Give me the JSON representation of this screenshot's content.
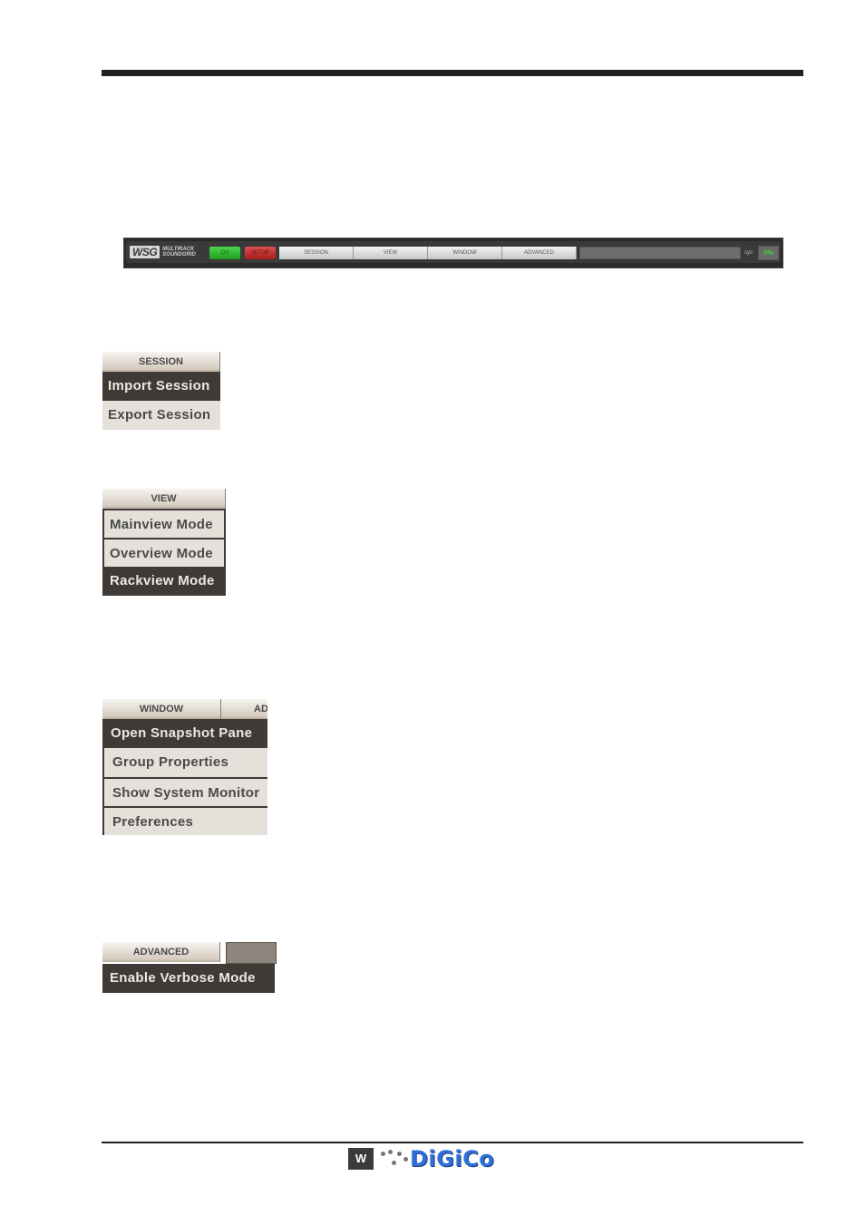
{
  "toolbar": {
    "logo_mark": "WSG",
    "logo_line1": "MULTIRACK",
    "logo_line2": "SOUNDGRID",
    "on_label": "ON",
    "setup_label": "SETUP",
    "menus": [
      "SESSION",
      "VIEW",
      "WINDOW",
      "ADVANCED"
    ],
    "sys_label": "sys",
    "sys_value": "0%",
    "colors": {
      "on": "#2fbf2f",
      "setup": "#c92a2a",
      "sys_value": "#2fe02f"
    }
  },
  "session_menu": {
    "header": "SESSION",
    "items": [
      {
        "label": "Import Session",
        "highlighted": true
      },
      {
        "label": "Export Session",
        "highlighted": false
      }
    ]
  },
  "view_menu": {
    "header": "VIEW",
    "items": [
      {
        "label": "Mainview Mode",
        "highlighted": false
      },
      {
        "label": "Overview Mode",
        "highlighted": false
      },
      {
        "label": "Rackview Mode",
        "highlighted": true
      }
    ]
  },
  "window_menu": {
    "header": "WINDOW",
    "next_header_partial": "AD",
    "items": [
      {
        "label": "Open Snapshot Pane",
        "highlighted": true
      },
      {
        "label": "Group Properties",
        "highlighted": false
      },
      {
        "label": "Show System Monitor",
        "highlighted": false
      },
      {
        "label": "Preferences",
        "highlighted": false
      }
    ]
  },
  "advanced_menu": {
    "header": "ADVANCED",
    "items": [
      {
        "label": "Enable Verbose Mode",
        "highlighted": true
      }
    ]
  },
  "footer": {
    "waves_mark": "W",
    "brand": "DiGiCo"
  }
}
